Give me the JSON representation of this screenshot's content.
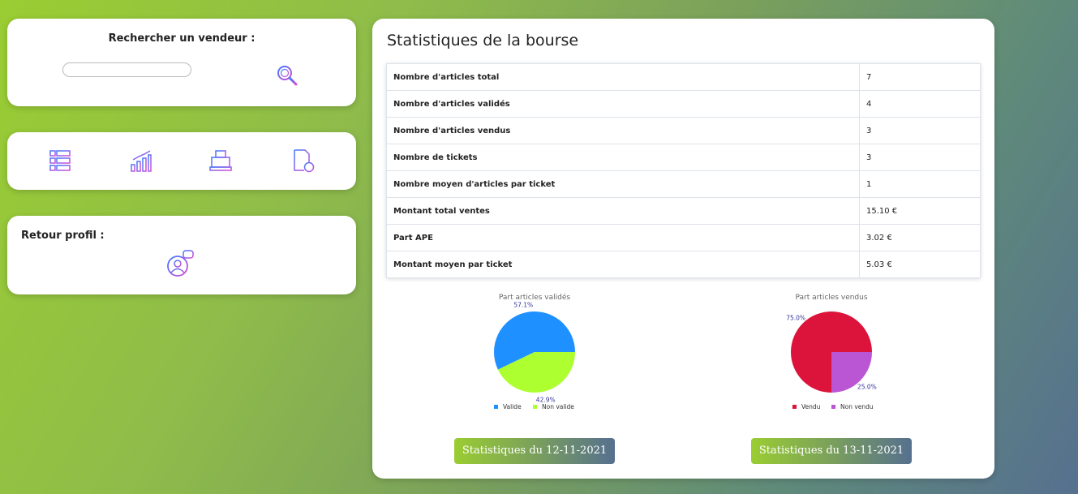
{
  "search": {
    "title": "Rechercher un vendeur :",
    "value": "",
    "placeholder": ""
  },
  "tools": [
    {
      "icon": "checklist-icon"
    },
    {
      "icon": "stats-chart-icon"
    },
    {
      "icon": "cash-register-icon"
    },
    {
      "icon": "add-document-icon"
    }
  ],
  "profile": {
    "label": "Retour profil :"
  },
  "stats": {
    "title": "Statistiques de la bourse",
    "rows": [
      {
        "label": "Nombre d'articles total",
        "value": "7"
      },
      {
        "label": "Nombre d'articles validés",
        "value": "4"
      },
      {
        "label": "Nombre d'articles vendus",
        "value": "3"
      },
      {
        "label": "Nombre de tickets",
        "value": "3"
      },
      {
        "label": "Nombre moyen d'articles par ticket",
        "value": "1"
      },
      {
        "label": "Montant total ventes",
        "value": "15.10 €"
      },
      {
        "label": "Part APE",
        "value": "3.02 €"
      },
      {
        "label": "Montant moyen par ticket",
        "value": "5.03 €"
      }
    ]
  },
  "chart_data": [
    {
      "type": "pie",
      "title": "Part articles validés",
      "categories": [
        "Valide",
        "Non valide"
      ],
      "values": [
        57.1,
        42.9
      ],
      "labels": [
        "57.1%",
        "42.9%"
      ],
      "colors": [
        "#1e90ff",
        "#adff2f"
      ],
      "legend": "bottom"
    },
    {
      "type": "pie",
      "title": "Part articles vendus",
      "categories": [
        "Vendu",
        "Non vendu"
      ],
      "values": [
        75.0,
        25.0
      ],
      "labels": [
        "75.0%",
        "25.0%"
      ],
      "colors": [
        "#dc143c",
        "#ba55d3"
      ],
      "legend": "bottom"
    }
  ],
  "buttons": [
    {
      "label": "Statistiques du 12-11-2021"
    },
    {
      "label": "Statistiques du 13-11-2021"
    }
  ]
}
